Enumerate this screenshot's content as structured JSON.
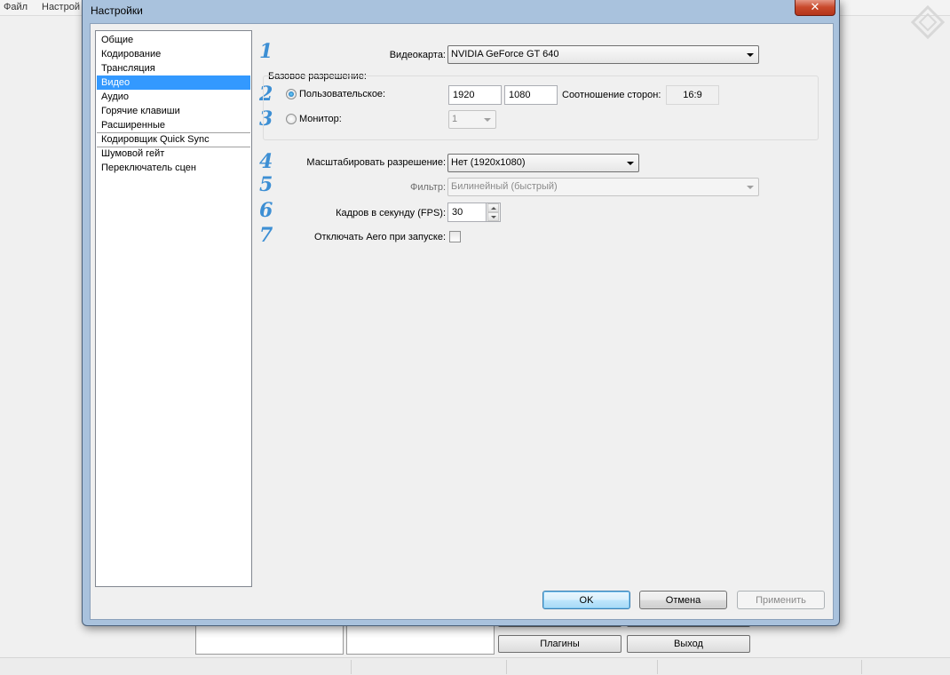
{
  "app": {
    "menu": [
      "Файл",
      "Настрой"
    ],
    "buttons": {
      "plugins": "Плагины",
      "exit": "Выход"
    }
  },
  "dialog": {
    "title": "Настройки",
    "close_glyph": "✕",
    "nav": [
      "Общие",
      "Кодирование",
      "Трансляция",
      "Видео",
      "Аудио",
      "Горячие клавиши",
      "Расширенные",
      "Кодировщик Quick Sync",
      "Шумовой гейт",
      "Переключатель сцен"
    ],
    "selected_nav": "Видео",
    "steps": [
      "1",
      "2",
      "3",
      "4",
      "5",
      "6",
      "7"
    ],
    "video": {
      "gpu_label": "Видеокарта:",
      "gpu_value": "NVIDIA GeForce GT 640",
      "base_res_label": "Базовое разрешение:",
      "custom_label": "Пользовательское:",
      "custom_checked": true,
      "width": "1920",
      "height": "1080",
      "aspect_label": "Соотношение сторон:",
      "aspect_value": "16:9",
      "monitor_label": "Монитор:",
      "monitor_value": "1",
      "scale_label": "Масштабировать разрешение:",
      "scale_value": "Нет  (1920x1080)",
      "filter_label": "Фильтр:",
      "filter_value": "Билинейный (быстрый)",
      "fps_label": "Кадров в секунду (FPS):",
      "fps_value": "30",
      "aero_label": "Отключать Aero при запуске:",
      "aero_checked": false
    },
    "buttons": {
      "ok": "OK",
      "cancel": "Отмена",
      "apply": "Применить"
    }
  },
  "colors": {
    "accent": "#3399ff",
    "step_numbers": "#3d8fd4",
    "close_button": "#c94a2c"
  }
}
